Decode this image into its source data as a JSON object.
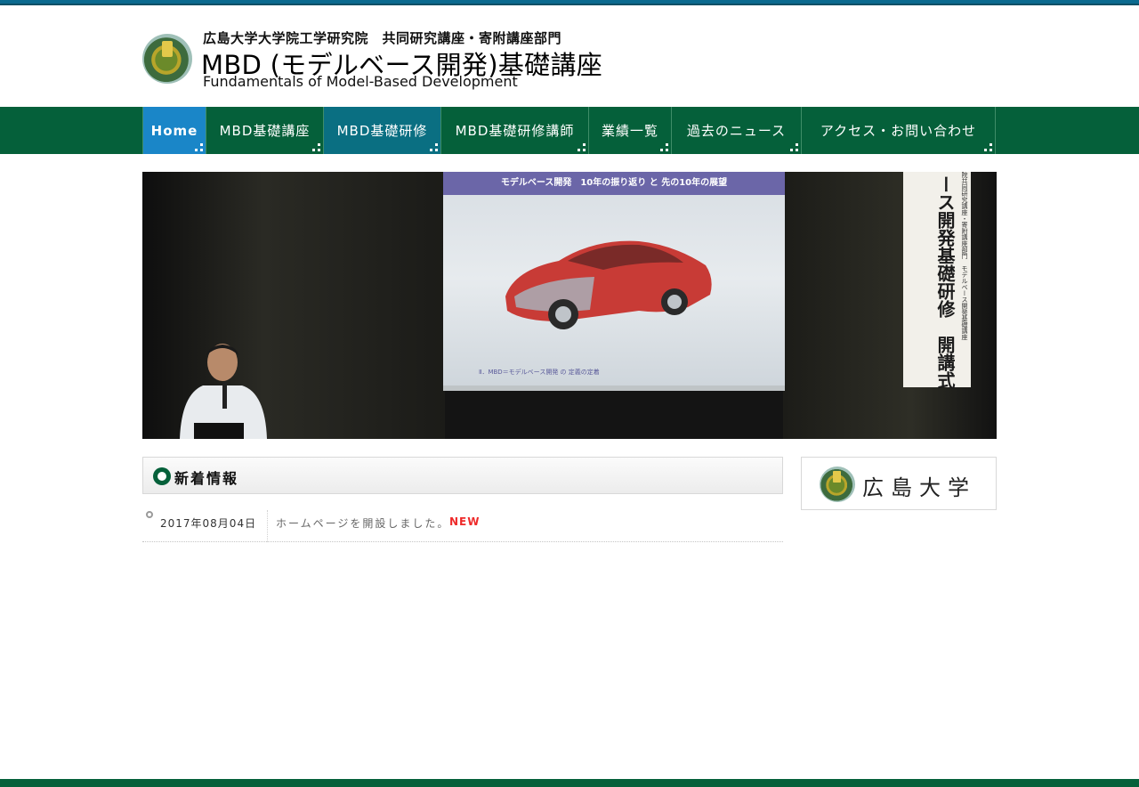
{
  "header": {
    "subtitle": "広島大学大学院工学研究院　共同研究講座・寄附講座部門",
    "title": "MBD (モデルベース開発)基礎講座",
    "english": "Fundamentals of Model-Based Development"
  },
  "nav": {
    "items": [
      {
        "label": "Home"
      },
      {
        "label": "MBD基礎講座"
      },
      {
        "label": "MBD基礎研修"
      },
      {
        "label": "MBD基礎研修講師"
      },
      {
        "label": "業績一覧"
      },
      {
        "label": "過去のニュース"
      },
      {
        "label": "アクセス・お問い合わせ"
      }
    ]
  },
  "hero": {
    "slide_title": "モデルベース開発　10年の振り返り と 先の10年の展望",
    "slide_footer": "Ⅱ．MBD＝モデルベース開発 の 定義の定着",
    "banner_text": "ース開発基礎研修　開講式",
    "banner_small": "院共同研究講座・寄附講座部門　モデルベース開発基礎講座"
  },
  "news": {
    "heading": "新着情報",
    "items": [
      {
        "date": "2017年08月04日",
        "text": "ホームページを開設しました。",
        "badge": "NEW"
      }
    ]
  },
  "sidebar": {
    "banner_label": "広島大学"
  },
  "colors": {
    "nav_bg": "#05603a",
    "nav_active": "#1a86c8",
    "nav_secondary": "#0a6f82",
    "new_badge": "#ee2a2a",
    "top_bar": "#0b6a8f"
  },
  "icons": {
    "logo": "hiroshima-university-emblem-icon",
    "heading": "circle-bullet-icon",
    "nav_corner": "corner-dots-icon",
    "news_bullet": "ring-bullet-icon"
  }
}
